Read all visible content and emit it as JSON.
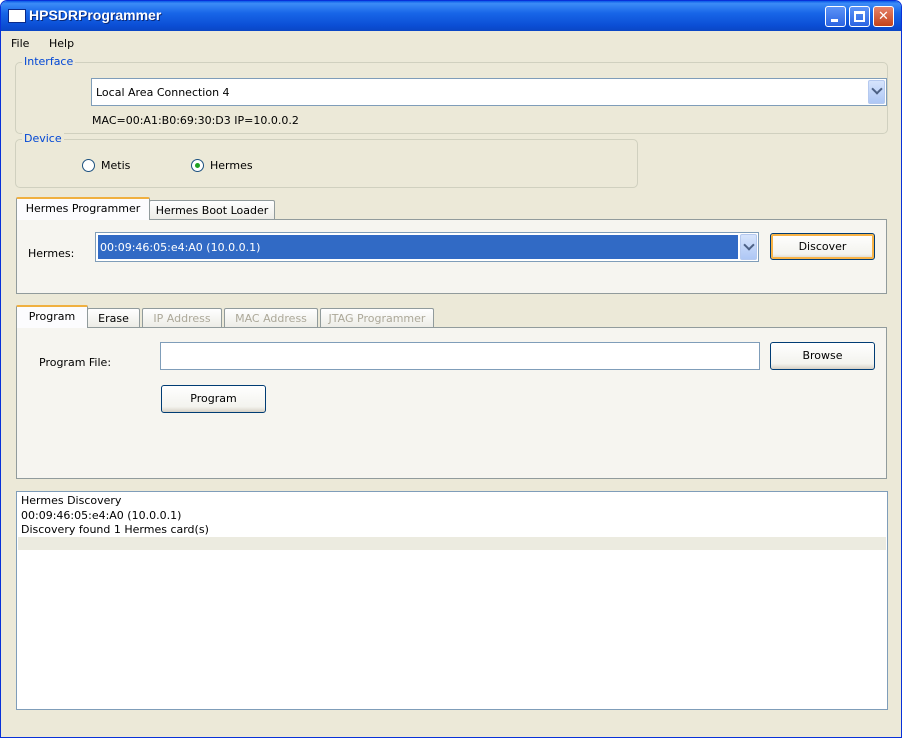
{
  "window": {
    "title": "HPSDRProgrammer"
  },
  "menu": [
    "File",
    "Help"
  ],
  "interface": {
    "group_title": "Interface",
    "selected": "Local Area Connection 4",
    "info": "MAC=00:A1:B0:69:30:D3  IP=10.0.0.2"
  },
  "device": {
    "group_title": "Device",
    "options": [
      {
        "label": "Metis",
        "checked": false
      },
      {
        "label": "Hermes",
        "checked": true
      }
    ]
  },
  "top_tabs": [
    "Hermes Programmer",
    "Hermes Boot Loader"
  ],
  "hermes": {
    "label": "Hermes:",
    "selected": "00:09:46:05:e4:A0 (10.0.0.1)",
    "discover_label": "Discover"
  },
  "sub_tabs": [
    {
      "label": "Program",
      "enabled": true
    },
    {
      "label": "Erase",
      "enabled": true
    },
    {
      "label": "IP Address",
      "enabled": false
    },
    {
      "label": "MAC Address",
      "enabled": false
    },
    {
      "label": "JTAG Programmer",
      "enabled": false
    }
  ],
  "program": {
    "file_label": "Program File:",
    "file_value": "",
    "browse_label": "Browse",
    "program_label": "Program"
  },
  "log": [
    "Hermes Discovery",
    "00:09:46:05:e4:A0 (10.0.0.1)",
    "Discovery found 1 Hermes card(s)"
  ],
  "colors": {
    "titlebar": "#0b4fd6",
    "group_title": "#0046d5",
    "selection": "#316ac5",
    "window_bg": "#ece9d8"
  }
}
